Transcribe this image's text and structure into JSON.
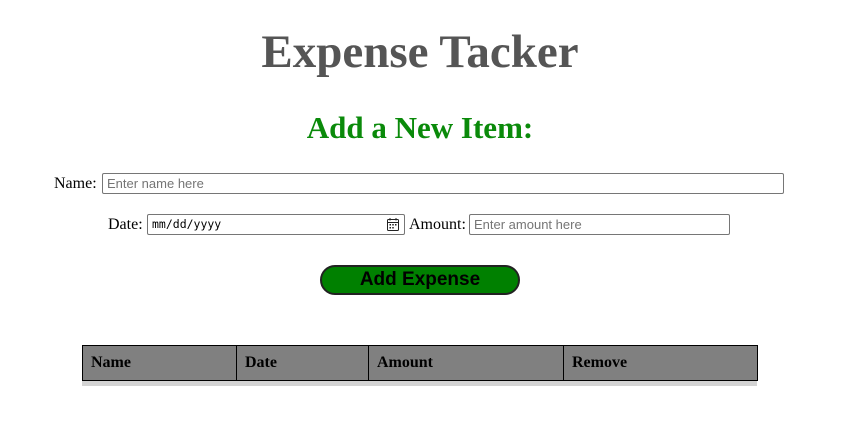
{
  "header": {
    "title": "Expense Tacker"
  },
  "form": {
    "heading": "Add a New Item:",
    "name_label": "Name:",
    "name_placeholder": "Enter name here",
    "name_value": "",
    "date_label": "Date:",
    "date_display": "mm/dd/yyyy",
    "date_icon": "calendar-icon",
    "amount_label": "Amount:",
    "amount_placeholder": "Enter amount here",
    "amount_value": "",
    "submit_label": "Add Expense"
  },
  "table": {
    "columns": [
      "Name",
      "Date",
      "Amount",
      "Remove"
    ],
    "rows": []
  },
  "colors": {
    "title": "#555555",
    "heading": "#0a8a0a",
    "button_bg": "#008000",
    "table_header_bg": "#808080"
  }
}
